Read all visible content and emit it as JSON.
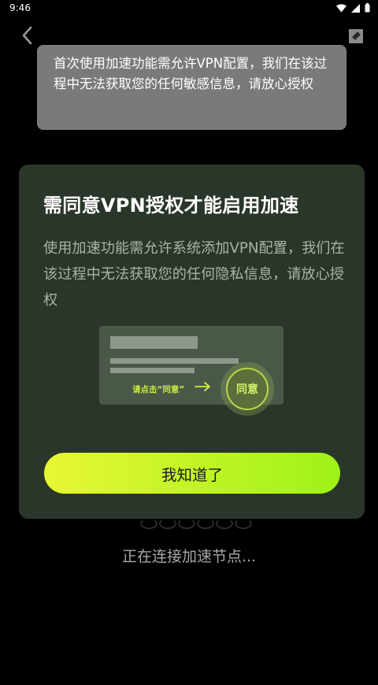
{
  "status_bar": {
    "time": "9:46"
  },
  "tooltip": {
    "text": "首次使用加速功能需允许VPN配置，我们在该过程中无法获取您的任何敏感信息，请放心授权"
  },
  "dialog": {
    "title": "需同意VPN授权才能启用加速",
    "description": "使用加速功能需允许系统添加VPN配置，我们在该过程中无法获取您的任何隐私信息，请放心授权",
    "illustration": {
      "hint": "请点击“同意”",
      "agree_label": "同意"
    },
    "ok_label": "我知道了"
  },
  "background": {
    "loading_text": "正在连接加速节点..."
  },
  "colors": {
    "accent_start": "#e8f733",
    "accent_end": "#9ef218",
    "dialog_bg": "#2a3629",
    "tooltip_bg": "#7a7a7a"
  },
  "icons": {
    "back": "chevron-left-icon",
    "edit": "edit-icon",
    "wifi": "wifi-icon",
    "signal": "signal-icon",
    "battery": "battery-icon"
  }
}
